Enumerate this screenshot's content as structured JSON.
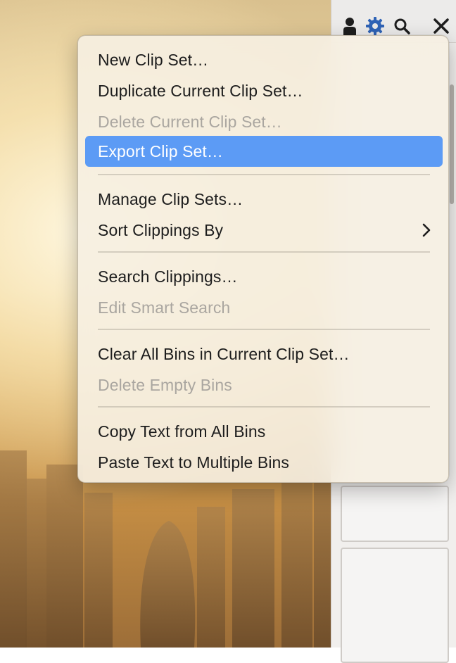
{
  "toolbar": {
    "icons": [
      "person-icon",
      "gear-icon",
      "search-icon",
      "close-icon"
    ],
    "gear_color": "#2f63b6"
  },
  "menu": {
    "items": [
      {
        "label": "New Clip Set…",
        "enabled": true
      },
      {
        "label": "Duplicate Current Clip Set…",
        "enabled": true
      },
      {
        "label": "Delete Current Clip Set…",
        "enabled": false
      },
      {
        "label": "Export Clip Set…",
        "enabled": true,
        "highlighted": true
      },
      {
        "label": "Manage Clip Sets…",
        "enabled": true
      },
      {
        "label": "Sort Clippings By",
        "enabled": true,
        "has_submenu": true
      },
      {
        "label": "Search Clippings…",
        "enabled": true
      },
      {
        "label": "Edit Smart Search",
        "enabled": false
      },
      {
        "label": "Clear All Bins in Current Clip Set…",
        "enabled": true
      },
      {
        "label": "Delete Empty Bins",
        "enabled": false
      },
      {
        "label": "Copy Text from All Bins",
        "enabled": true
      },
      {
        "label": "Paste Text to Multiple Bins",
        "enabled": true
      }
    ]
  },
  "colors": {
    "highlight": "#5c9bf5",
    "disabled_text": "#aaa6a0"
  }
}
